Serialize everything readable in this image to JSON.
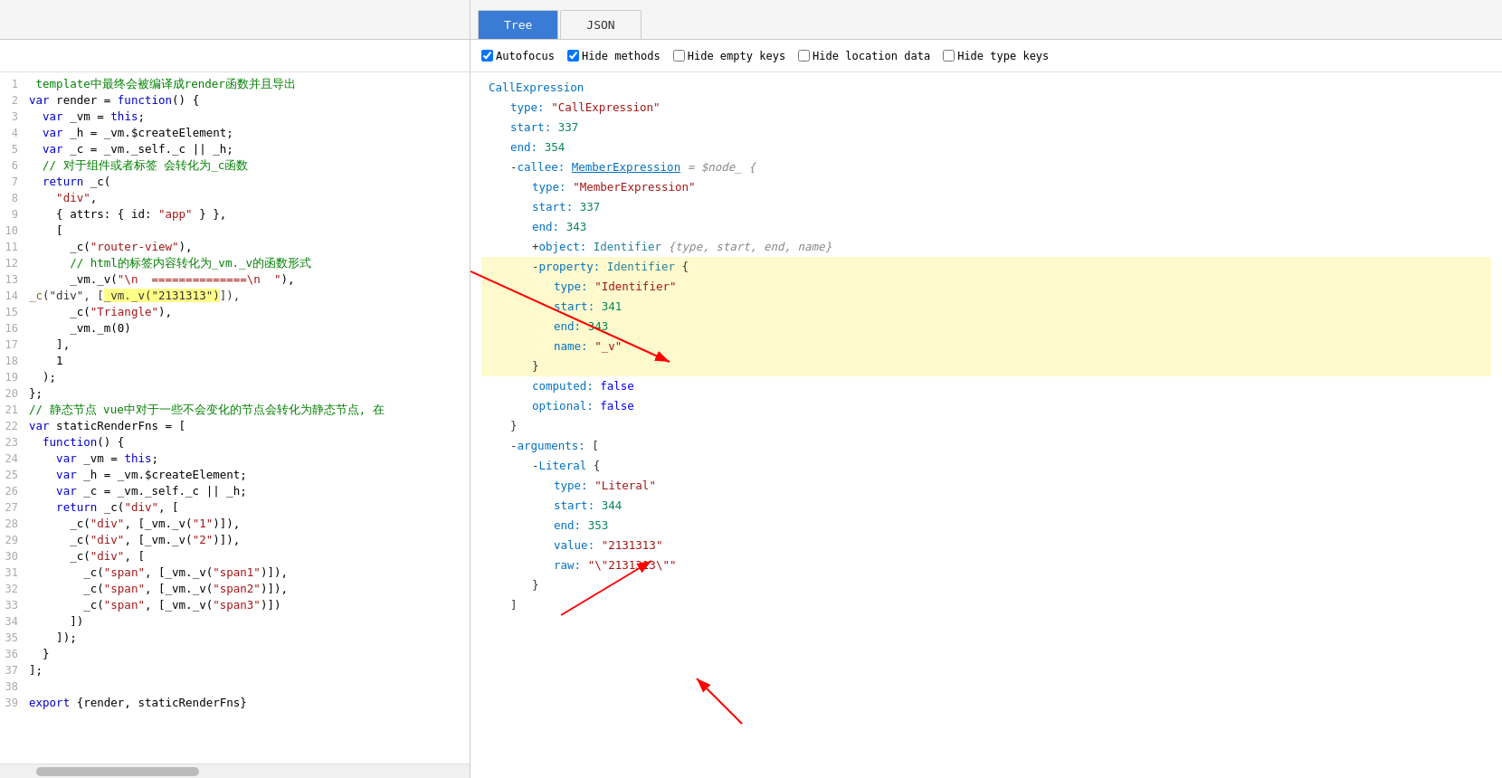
{
  "tabs": {
    "tree_label": "Tree",
    "json_label": "JSON"
  },
  "options": {
    "autofocus_label": "Autofocus",
    "autofocus_checked": true,
    "hide_methods_label": "Hide methods",
    "hide_methods_checked": true,
    "hide_empty_keys_label": "Hide empty keys",
    "hide_empty_keys_checked": false,
    "hide_location_data_label": "Hide location data",
    "hide_location_data_checked": false,
    "hide_type_keys_label": "Hide type keys",
    "hide_type_keys_checked": false
  },
  "code_lines": [
    {
      "num": 1,
      "text": " template中最终会被编译成render函数并且导出",
      "type": "comment"
    },
    {
      "num": 2,
      "text": "var render = function() {",
      "type": "plain"
    },
    {
      "num": 3,
      "text": "  var _vm = this;",
      "type": "plain"
    },
    {
      "num": 4,
      "text": "  var _h = _vm.$createElement;",
      "type": "plain"
    },
    {
      "num": 5,
      "text": "  var _c = _vm._self._c || _h;",
      "type": "plain"
    },
    {
      "num": 6,
      "text": "  // 对于组件或者标签 会转化为_c函数",
      "type": "comment"
    },
    {
      "num": 7,
      "text": "  return _c(",
      "type": "plain"
    },
    {
      "num": 8,
      "text": "    \"div\",",
      "type": "plain"
    },
    {
      "num": 9,
      "text": "    { attrs: { id: \"app\" } },",
      "type": "plain"
    },
    {
      "num": 10,
      "text": "    [",
      "type": "plain"
    },
    {
      "num": 11,
      "text": "      _c(\"router-view\"),",
      "type": "plain"
    },
    {
      "num": 12,
      "text": "      // html的标签内容转化为_vm._v的函数形式",
      "type": "comment"
    },
    {
      "num": 13,
      "text": "      _vm._v(\"\\n  ==============\\n  \"),",
      "type": "plain"
    },
    {
      "num": 14,
      "text": "      _c(\"div\", [_vm._v(\"2131313\")]),",
      "type": "plain",
      "highlight": true
    },
    {
      "num": 15,
      "text": "      _c(\"Triangle\"),",
      "type": "plain"
    },
    {
      "num": 16,
      "text": "      _vm._m(0)",
      "type": "plain"
    },
    {
      "num": 17,
      "text": "    ],",
      "type": "plain"
    },
    {
      "num": 18,
      "text": "    1",
      "type": "plain"
    },
    {
      "num": 19,
      "text": "  );",
      "type": "plain"
    },
    {
      "num": 20,
      "text": "};",
      "type": "plain"
    },
    {
      "num": 21,
      "text": "// 静态节点 vue中对于一些不会变化的节点会转化为静态节点, 在",
      "type": "comment"
    },
    {
      "num": 22,
      "text": "var staticRenderFns = [",
      "type": "plain"
    },
    {
      "num": 23,
      "text": "  function() {",
      "type": "plain"
    },
    {
      "num": 24,
      "text": "    var _vm = this;",
      "type": "plain"
    },
    {
      "num": 25,
      "text": "    var _h = _vm.$createElement;",
      "type": "plain"
    },
    {
      "num": 26,
      "text": "    var _c = _vm._self._c || _h;",
      "type": "plain"
    },
    {
      "num": 27,
      "text": "    return _c(\"div\", [",
      "type": "plain"
    },
    {
      "num": 28,
      "text": "      _c(\"div\", [_vm._v(\"1\")]),",
      "type": "plain"
    },
    {
      "num": 29,
      "text": "      _c(\"div\", [_vm._v(\"2\")]),",
      "type": "plain"
    },
    {
      "num": 30,
      "text": "      _c(\"div\", [",
      "type": "plain"
    },
    {
      "num": 31,
      "text": "        _c(\"span\", [_vm._v(\"span1\")]),",
      "type": "plain"
    },
    {
      "num": 32,
      "text": "        _c(\"span\", [_vm._v(\"span2\")]),",
      "type": "plain"
    },
    {
      "num": 33,
      "text": "        _c(\"span\", [_vm._v(\"span3\")])",
      "type": "plain"
    },
    {
      "num": 34,
      "text": "      ])",
      "type": "plain"
    },
    {
      "num": 35,
      "text": "    ]);",
      "type": "plain"
    },
    {
      "num": 36,
      "text": "  }",
      "type": "plain"
    },
    {
      "num": 37,
      "text": "];",
      "type": "plain"
    },
    {
      "num": 38,
      "text": "",
      "type": "plain"
    },
    {
      "num": 39,
      "text": "export {render, staticRenderFns}",
      "type": "plain"
    }
  ],
  "tree_nodes": [
    {
      "indent": 0,
      "prefix": "",
      "key": "CallExpression",
      "colon": ".",
      "value": "",
      "expand": "partial"
    },
    {
      "indent": 1,
      "prefix": "",
      "key": "type:",
      "colon": "",
      "value": "\"CallExpression\"",
      "vtype": "string"
    },
    {
      "indent": 1,
      "prefix": "",
      "key": "start:",
      "colon": "",
      "value": "337",
      "vtype": "number"
    },
    {
      "indent": 1,
      "prefix": "",
      "key": "end:",
      "colon": "",
      "value": "354",
      "vtype": "number"
    },
    {
      "indent": 1,
      "prefix": "- ",
      "key": "callee:",
      "colon": "",
      "value": "MemberExpression",
      "link": true,
      "extra": "= $node_  {",
      "vtype": "link"
    },
    {
      "indent": 2,
      "prefix": "",
      "key": "type:",
      "colon": "",
      "value": "\"MemberExpression\"",
      "vtype": "string"
    },
    {
      "indent": 2,
      "prefix": "",
      "key": "start:",
      "colon": "",
      "value": "337",
      "vtype": "number"
    },
    {
      "indent": 2,
      "prefix": "",
      "key": "end:",
      "colon": "",
      "value": "343",
      "vtype": "number"
    },
    {
      "indent": 2,
      "prefix": "+ ",
      "key": "object:",
      "colon": "",
      "value": "Identifier",
      "extra": "{type, start, end, name}",
      "vtype": "compact",
      "highlighted": false
    },
    {
      "indent": 2,
      "prefix": "- ",
      "key": "property:",
      "colon": "",
      "value": "Identifier",
      "extra": "{",
      "vtype": "typeblock",
      "highlighted": true
    },
    {
      "indent": 3,
      "prefix": "",
      "key": "type:",
      "colon": "",
      "value": "\"Identifier\"",
      "vtype": "string",
      "highlighted": true
    },
    {
      "indent": 3,
      "prefix": "",
      "key": "start:",
      "colon": "",
      "value": "341",
      "vtype": "number",
      "highlighted": true
    },
    {
      "indent": 3,
      "prefix": "",
      "key": "end:",
      "colon": "",
      "value": "343",
      "vtype": "number",
      "highlighted": true
    },
    {
      "indent": 3,
      "prefix": "",
      "key": "name:",
      "colon": "",
      "value": "\"_v\"",
      "vtype": "string",
      "highlighted": true
    },
    {
      "indent": 2,
      "prefix": "}",
      "key": "",
      "colon": "",
      "value": "",
      "highlighted": true
    },
    {
      "indent": 2,
      "prefix": "",
      "key": "computed:",
      "colon": "",
      "value": "false",
      "vtype": "bool"
    },
    {
      "indent": 2,
      "prefix": "",
      "key": "optional:",
      "colon": "",
      "value": "false",
      "vtype": "bool"
    },
    {
      "indent": 1,
      "prefix": "}",
      "key": "",
      "colon": "",
      "value": ""
    },
    {
      "indent": 1,
      "prefix": "- ",
      "key": "arguments:",
      "colon": "",
      "value": "[",
      "vtype": "plain"
    },
    {
      "indent": 2,
      "prefix": "- ",
      "key": "Literal",
      "colon": "",
      "value": "{",
      "vtype": "plain"
    },
    {
      "indent": 3,
      "prefix": "",
      "key": "type:",
      "colon": "",
      "value": "\"Literal\"",
      "vtype": "string"
    },
    {
      "indent": 3,
      "prefix": "",
      "key": "start:",
      "colon": "",
      "value": "344",
      "vtype": "number"
    },
    {
      "indent": 3,
      "prefix": "",
      "key": "end:",
      "colon": "",
      "value": "353",
      "vtype": "number"
    },
    {
      "indent": 3,
      "prefix": "",
      "key": "value:",
      "colon": "",
      "value": "\"2131313\"",
      "vtype": "string"
    },
    {
      "indent": 3,
      "prefix": "",
      "key": "raw:",
      "colon": "",
      "value": "\"\\\"2131313\\\"\"",
      "vtype": "string"
    },
    {
      "indent": 2,
      "prefix": "}",
      "key": "",
      "colon": "",
      "value": ""
    },
    {
      "indent": 1,
      "prefix": "]",
      "key": "",
      "colon": "",
      "value": ""
    }
  ],
  "colors": {
    "tab_active_bg": "#3a7bd5",
    "tab_active_text": "#ffffff",
    "highlight_bg": "#fffacd",
    "highlight_border": "#e8e000"
  }
}
